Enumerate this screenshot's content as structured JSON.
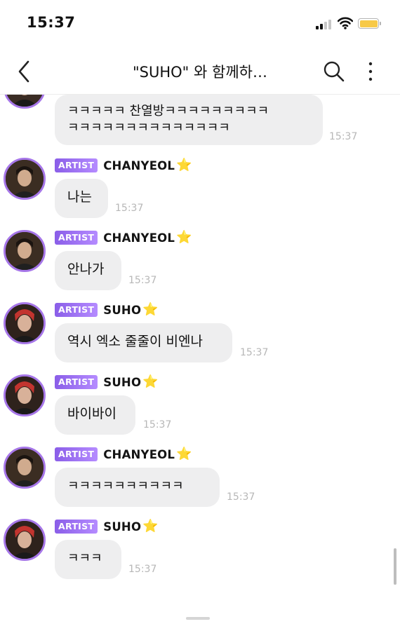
{
  "status_bar": {
    "time": "15:37",
    "battery_color": "#f7c948"
  },
  "header": {
    "title": "\"SUHO\" 와 함께하…",
    "back_icon": "chevron-left-icon",
    "search_icon": "search-icon",
    "more_icon": "more-vertical-icon"
  },
  "first_message": {
    "line1": "ㅋㅋㅋㅋㅋ 찬열방ㅋㅋㅋㅋㅋㅋㅋㅋㅋ",
    "line2": "ㅋㅋㅋㅋㅋㅋㅋㅋㅋㅋㅋㅋㅋㅋ",
    "time": "15:37"
  },
  "messages": [
    {
      "badge": "ARTIST",
      "sender": "CHANYEOL",
      "star": "⭐",
      "text": "나는",
      "time": "15:37"
    },
    {
      "badge": "ARTIST",
      "sender": "CHANYEOL",
      "star": "⭐",
      "text": "안나가",
      "time": "15:37"
    },
    {
      "badge": "ARTIST",
      "sender": "SUHO",
      "star": "⭐",
      "text": "역시 엑소 줄줄이 비엔나",
      "time": "15:37"
    },
    {
      "badge": "ARTIST",
      "sender": "SUHO",
      "star": "⭐",
      "text": "바이바이",
      "time": "15:37"
    },
    {
      "badge": "ARTIST",
      "sender": "CHANYEOL",
      "star": "⭐",
      "text": "ㅋㅋㅋㅋㅋㅋㅋㅋㅋㅋ",
      "time": "15:37"
    },
    {
      "badge": "ARTIST",
      "sender": "SUHO",
      "star": "⭐",
      "text": "ㅋㅋㅋ",
      "time": "15:37"
    }
  ],
  "colors": {
    "badge": "#8a5ee8",
    "avatar_ring": "#a676e8",
    "bubble": "#eeeeef",
    "timestamp": "#b7b7b7"
  }
}
